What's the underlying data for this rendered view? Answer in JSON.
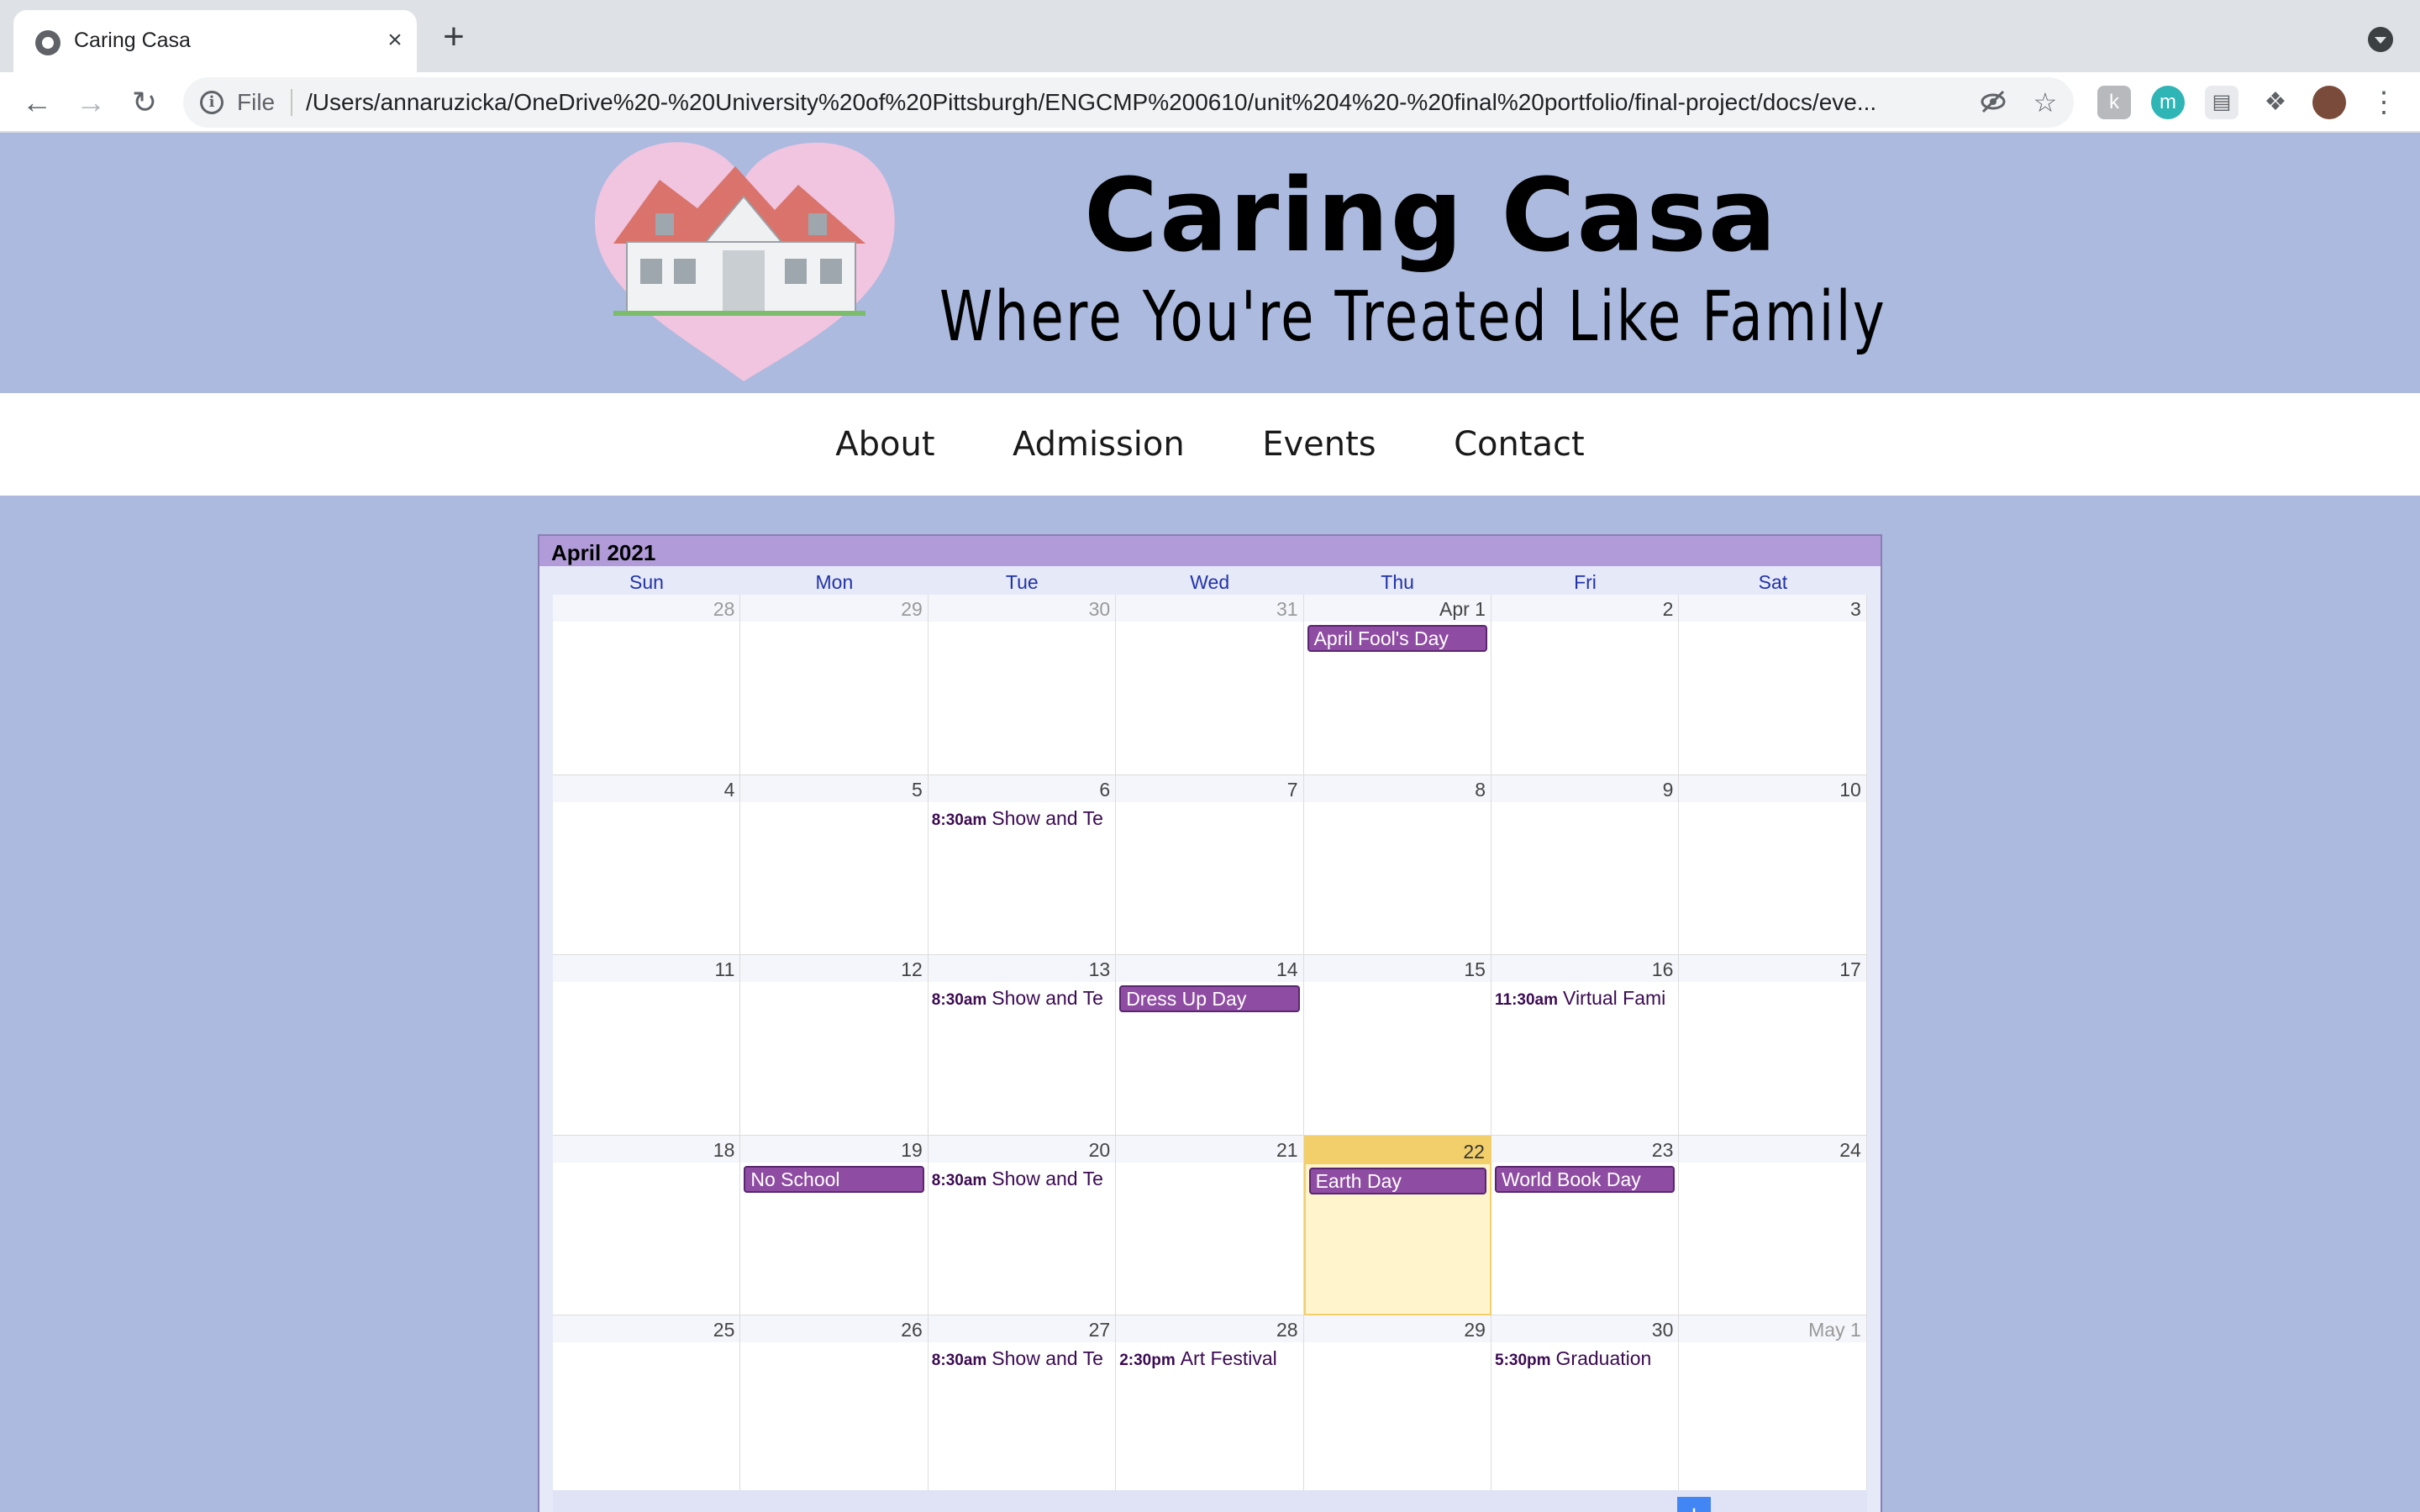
{
  "browser": {
    "tab_title": "Caring Casa",
    "tab_close": "×",
    "new_tab": "+",
    "scheme": "File",
    "url": "/Users/annaruzicka/OneDrive%20-%20University%20of%20Pittsburgh/ENGCMP%200610/unit%204%20-%20final%20portfolio/final-project/docs/eve..."
  },
  "site": {
    "title": "Caring Casa",
    "tagline": "Where You're Treated Like Family",
    "nav": [
      "About",
      "Admission",
      "Events",
      "Contact"
    ]
  },
  "calendar": {
    "month_title": "April 2021",
    "days_of_week": [
      "Sun",
      "Mon",
      "Tue",
      "Wed",
      "Thu",
      "Fri",
      "Sat"
    ],
    "weeks": [
      [
        {
          "num": "28",
          "other": true
        },
        {
          "num": "29",
          "other": true
        },
        {
          "num": "30",
          "other": true
        },
        {
          "num": "31",
          "other": true
        },
        {
          "num": "Apr 1",
          "events": [
            {
              "title": "April Fool's Day",
              "allday": true
            }
          ]
        },
        {
          "num": "2"
        },
        {
          "num": "3"
        }
      ],
      [
        {
          "num": "4"
        },
        {
          "num": "5"
        },
        {
          "num": "6",
          "events": [
            {
              "time": "8:30am",
              "title": "Show and Te"
            }
          ]
        },
        {
          "num": "7"
        },
        {
          "num": "8"
        },
        {
          "num": "9"
        },
        {
          "num": "10"
        }
      ],
      [
        {
          "num": "11"
        },
        {
          "num": "12"
        },
        {
          "num": "13",
          "events": [
            {
              "time": "8:30am",
              "title": "Show and Te"
            }
          ]
        },
        {
          "num": "14",
          "events": [
            {
              "title": "Dress Up Day",
              "allday": true
            }
          ]
        },
        {
          "num": "15"
        },
        {
          "num": "16",
          "events": [
            {
              "time": "11:30am",
              "title": "Virtual Fami"
            }
          ]
        },
        {
          "num": "17"
        }
      ],
      [
        {
          "num": "18"
        },
        {
          "num": "19",
          "events": [
            {
              "title": "No School",
              "allday": true
            }
          ]
        },
        {
          "num": "20",
          "events": [
            {
              "time": "8:30am",
              "title": "Show and Te"
            }
          ]
        },
        {
          "num": "21"
        },
        {
          "num": "22",
          "today": true,
          "events": [
            {
              "title": "Earth Day",
              "allday": true
            }
          ]
        },
        {
          "num": "23",
          "events": [
            {
              "title": "World Book Day",
              "allday": true
            }
          ]
        },
        {
          "num": "24"
        }
      ],
      [
        {
          "num": "25"
        },
        {
          "num": "26"
        },
        {
          "num": "27",
          "events": [
            {
              "time": "8:30am",
              "title": "Show and Te"
            }
          ]
        },
        {
          "num": "28",
          "events": [
            {
              "time": "2:30pm",
              "title": "Art Festival"
            }
          ]
        },
        {
          "num": "29"
        },
        {
          "num": "30",
          "events": [
            {
              "time": "5:30pm",
              "title": "Graduation"
            }
          ]
        },
        {
          "num": "May 1",
          "other": true
        }
      ]
    ],
    "footer_badge": "+",
    "colors": {
      "event": "#8e4ca3",
      "today": "#fff4cc",
      "header": "#b19cd9",
      "page_bg": "#abbade"
    }
  },
  "icons": {
    "back": "back-arrow-icon",
    "forward": "forward-arrow-icon",
    "reload": "reload-icon",
    "info": "info-icon",
    "eye_off": "eye-off-icon",
    "star": "star-icon",
    "extensions": "puzzle-icon",
    "menu": "kebab-menu-icon"
  }
}
